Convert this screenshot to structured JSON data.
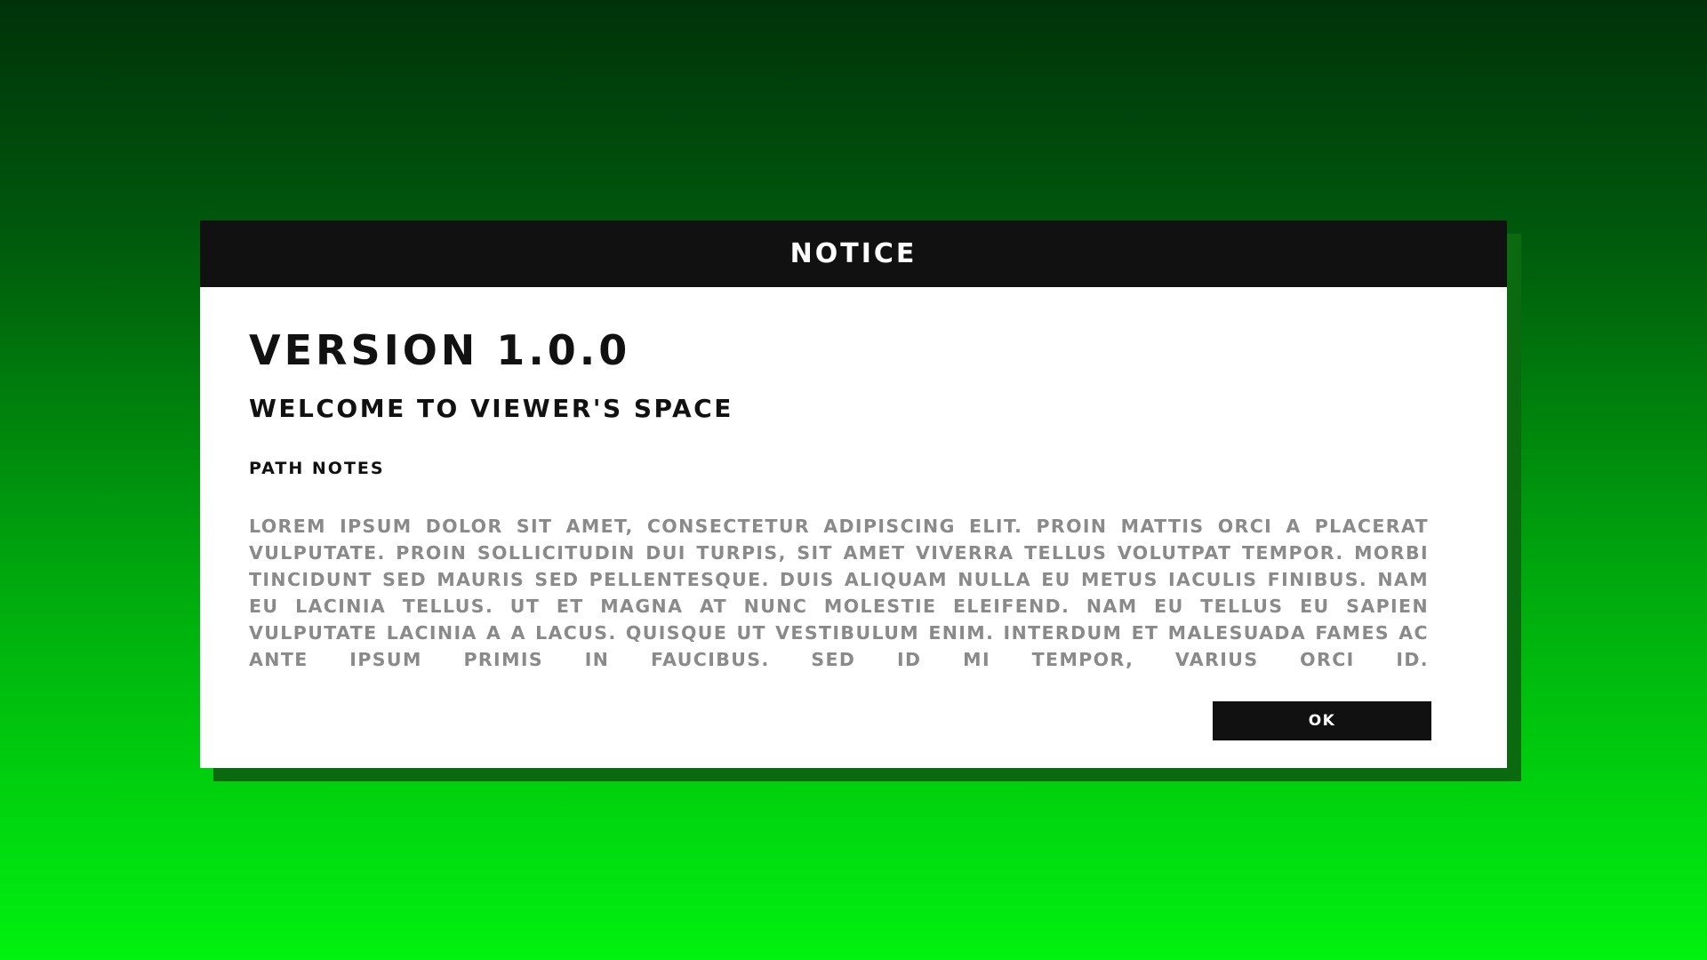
{
  "dialog": {
    "header_title": "NOTICE",
    "version_title": "VERSION 1.0.0",
    "welcome_title": "WELCOME TO VIEWER'S SPACE",
    "section_title": "PATH NOTES",
    "body_text": "LOREM IPSUM DOLOR SIT AMET, CONSECTETUR ADIPISCING ELIT. PROIN MATTIS ORCI A PLACERAT VULPUTATE. PROIN SOLLICITUDIN DUI TURPIS, SIT AMET VIVERRA TELLUS VOLUTPAT TEMPOR. MORBI TINCIDUNT SED MAURIS SED PELLENTESQUE. DUIS ALIQUAM NULLA EU METUS IACULIS FINIBUS. NAM EU LACINIA TELLUS. UT ET MAGNA AT NUNC MOLESTIE ELEIFEND. NAM EU TELLUS EU SAPIEN VULPUTATE LACINIA A A LACUS. QUISQUE UT VESTIBULUM ENIM. INTERDUM ET MALESUADA FAMES AC ANTE IPSUM PRIMIS IN FAUCIBUS. SED ID MI TEMPOR, VARIUS ORCI ID.",
    "ok_label": "OK"
  },
  "colors": {
    "background_top": "#00320a",
    "background_bottom": "#00f20f",
    "dialog_shadow": "#0b6a0f",
    "header_bg": "#111111",
    "body_text": "#8a8a8a"
  }
}
